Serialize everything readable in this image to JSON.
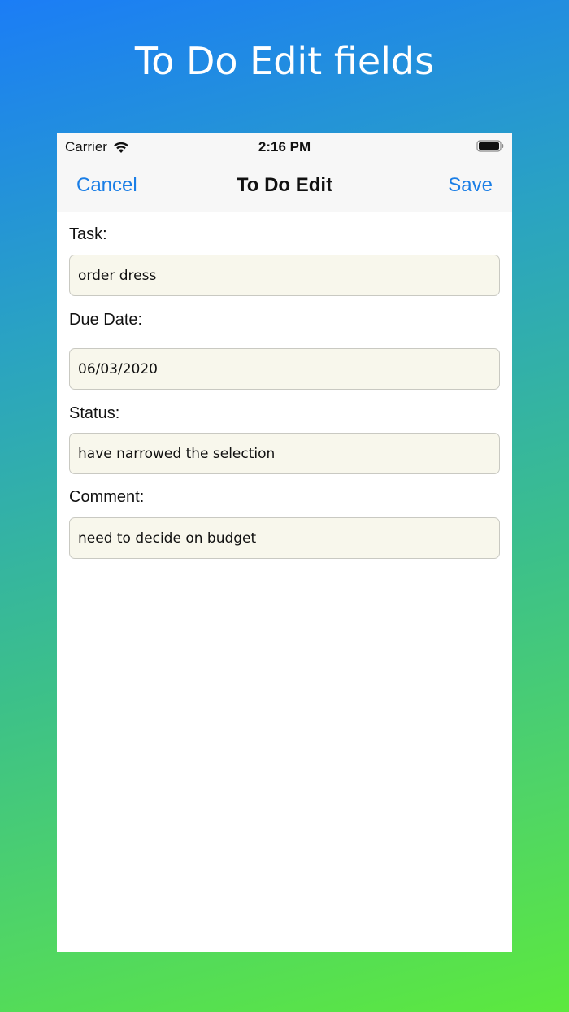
{
  "promo": {
    "title": "To Do Edit fields"
  },
  "status_bar": {
    "carrier": "Carrier",
    "time": "2:16 PM",
    "icons": [
      "wifi-icon",
      "battery-icon"
    ]
  },
  "nav": {
    "cancel_label": "Cancel",
    "title": "To Do Edit",
    "save_label": "Save"
  },
  "form": {
    "task": {
      "label": "Task:",
      "value": "order dress"
    },
    "due_date": {
      "label": "Due Date:",
      "value": "06/03/2020"
    },
    "status": {
      "label": "Status:",
      "value": "have narrowed the selection"
    },
    "comment": {
      "label": "Comment:",
      "value": "need to decide on budget"
    }
  },
  "colors": {
    "accent": "#1a7ee6",
    "field_background": "#f8f7ec",
    "gradient_top": "#1b7df6",
    "gradient_bottom": "#5ce93e"
  }
}
